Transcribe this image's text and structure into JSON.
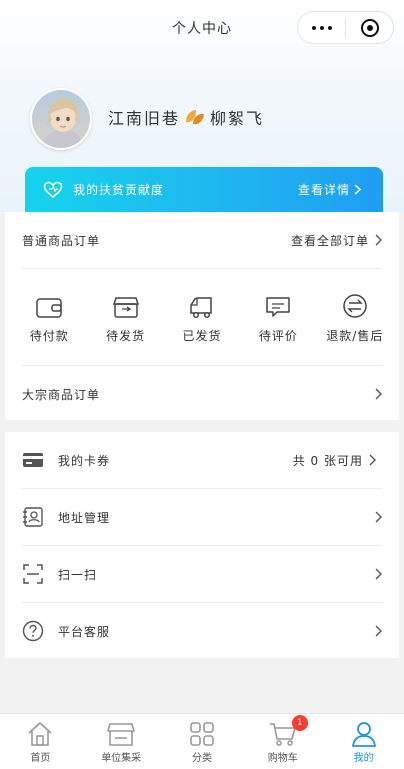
{
  "nav": {
    "title": "个人中心"
  },
  "profile": {
    "name_part1": "江南旧巷",
    "name_part2": "柳絮飞"
  },
  "contribution": {
    "label": "我的扶贫贡献度",
    "link": "查看详情"
  },
  "orders": {
    "title": "普通商品订单",
    "view_all": "查看全部订单",
    "statuses": [
      {
        "label": "待付款",
        "icon": "wallet-icon"
      },
      {
        "label": "待发货",
        "icon": "box-icon"
      },
      {
        "label": "已发货",
        "icon": "truck-icon"
      },
      {
        "label": "待评价",
        "icon": "comment-icon"
      },
      {
        "label": "退款/售后",
        "icon": "refund-icon"
      }
    ],
    "bulk_title": "大宗商品订单"
  },
  "menu": {
    "items": [
      {
        "label": "我的卡券",
        "right": "共 0 张可用",
        "icon": "card-icon"
      },
      {
        "label": "地址管理",
        "right": "",
        "icon": "address-icon"
      },
      {
        "label": "扫一扫",
        "right": "",
        "icon": "scan-icon"
      },
      {
        "label": "平台客服",
        "right": "",
        "icon": "help-icon"
      }
    ]
  },
  "tabbar": {
    "tabs": [
      {
        "label": "首页",
        "icon": "home-icon"
      },
      {
        "label": "单位集采",
        "icon": "store-icon"
      },
      {
        "label": "分类",
        "icon": "grid-icon"
      },
      {
        "label": "购物车",
        "icon": "cart-icon",
        "badge": "1"
      },
      {
        "label": "我的",
        "icon": "user-icon",
        "active": true
      }
    ]
  },
  "colors": {
    "accent": "#1b9ad6",
    "banner_start": "#16d3ec",
    "banner_end": "#1e9ef2",
    "badge": "#ff3b30"
  }
}
